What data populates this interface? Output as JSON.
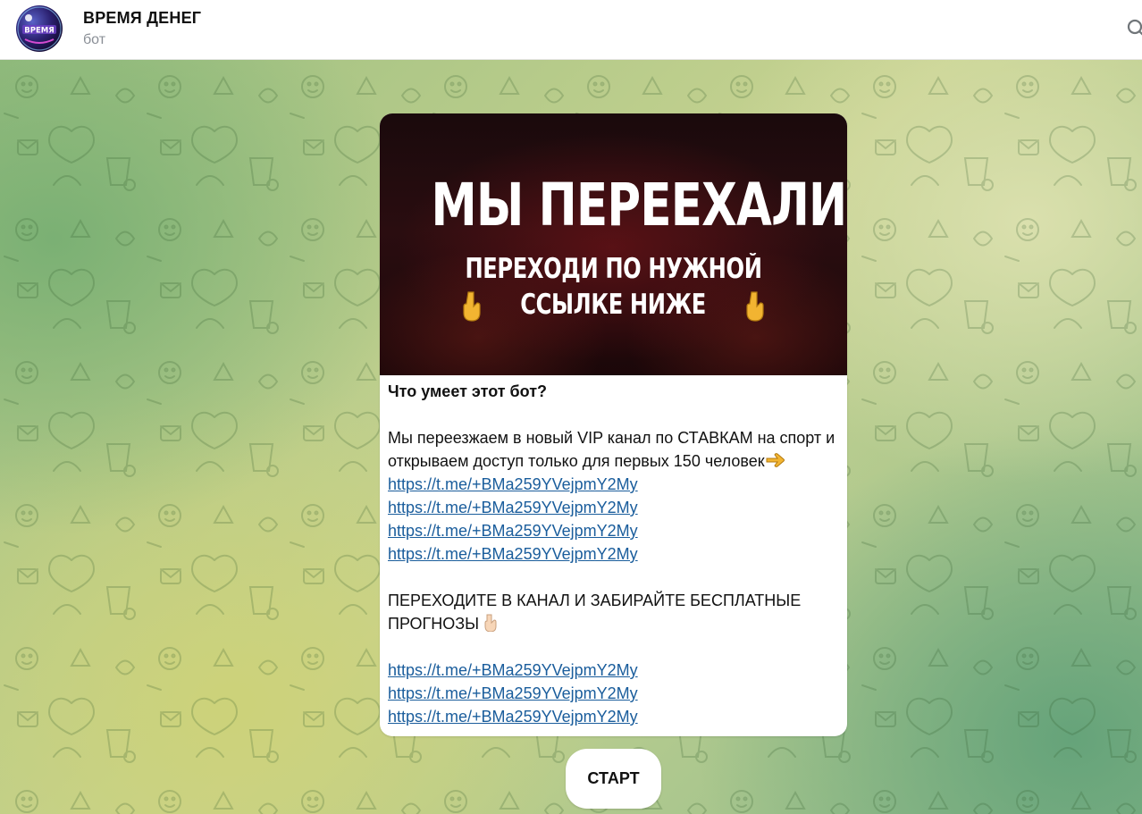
{
  "header": {
    "title": "ВРЕМЯ ДЕНЕГ",
    "subtitle": "бот",
    "avatar_text": "ВРЕМЯ"
  },
  "message": {
    "banner": {
      "headline": "МЫ ПЕРЕЕХАЛИ",
      "line1": "ПЕРЕХОДИ ПО НУЖНОЙ",
      "line2": "ССЫЛКЕ НИЖЕ"
    },
    "question": "Что умеет этот бот?",
    "paragraph1": "Мы переезжаем в новый VIP канал по СТАВКАМ на спорт и открываем доступ только для первых 150 человек",
    "links_group1": [
      "https://t.me/+BMa259YVejpmY2My",
      "https://t.me/+BMa259YVejpmY2My",
      "https://t.me/+BMa259YVejpmY2My",
      "https://t.me/+BMa259YVejpmY2My"
    ],
    "paragraph2": "ПЕРЕХОДИТЕ В КАНАЛ И ЗАБИРАЙТЕ БЕСПЛАТНЫЕ ПРОГНОЗЫ",
    "links_group2": [
      "https://t.me/+BMa259YVejpmY2My",
      "https://t.me/+BMa259YVejpmY2My",
      "https://t.me/+BMa259YVejpmY2My"
    ]
  },
  "start_button": {
    "label": "СТАРТ"
  },
  "colors": {
    "link": "#1a5d9c",
    "banner_bg": "#1b0709",
    "hand_emoji": "#f2b431"
  },
  "icons": [
    "search-icon",
    "point-right-emoji",
    "point-down-emoji",
    "point-down-hand-icon"
  ]
}
